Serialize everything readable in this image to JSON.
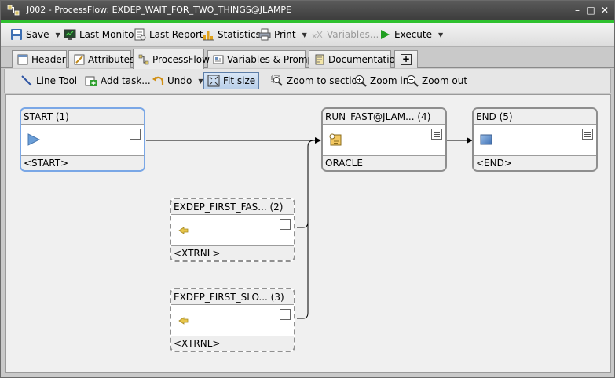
{
  "window": {
    "title": "J002 - ProcessFlow: EXDEP_WAIT_FOR_TWO_THINGS@JLAMPE",
    "minimize": "–",
    "restore": "□",
    "close": "✕"
  },
  "toolbar": {
    "save": "Save",
    "last_monitor": "Last Monitor",
    "last_report": "Last Report",
    "statistics": "Statistics",
    "print": "Print",
    "variables": "Variables...",
    "execute": "Execute"
  },
  "tabs": [
    {
      "label": "Header"
    },
    {
      "label": "Attributes"
    },
    {
      "label": "ProcessFlow",
      "active": true
    },
    {
      "label": "Variables & Prompts"
    },
    {
      "label": "Documentation"
    },
    {
      "label": "+"
    }
  ],
  "process_toolbar": {
    "line_tool": "Line Tool",
    "add_task": "Add task...",
    "undo": "Undo",
    "fit_size": "Fit size",
    "zoom_to_section": "Zoom to section",
    "zoom_in": "Zoom in",
    "zoom_out": "Zoom out"
  },
  "nodes": {
    "start": {
      "title": "START (1)",
      "footer": "<START>",
      "icon": "play-icon"
    },
    "first_fast": {
      "title": "EXDEP_FIRST_FAS... (2)",
      "footer": "<XTRNL>",
      "icon": "external-task-icon"
    },
    "first_slow": {
      "title": "EXDEP_FIRST_SLO... (3)",
      "footer": "<XTRNL>",
      "icon": "external-task-icon"
    },
    "run_fast": {
      "title": "RUN_FAST@JLAM... (4)",
      "footer": "ORACLE",
      "icon": "job-icon"
    },
    "end": {
      "title": "END (5)",
      "footer": "<END>",
      "icon": "end-icon"
    }
  },
  "colors": {
    "title_bar": "#4a4a4a",
    "accent_green": "#2fc12f",
    "selected_node_border": "#7aa7e6",
    "execute_green": "#1f9e1f"
  }
}
